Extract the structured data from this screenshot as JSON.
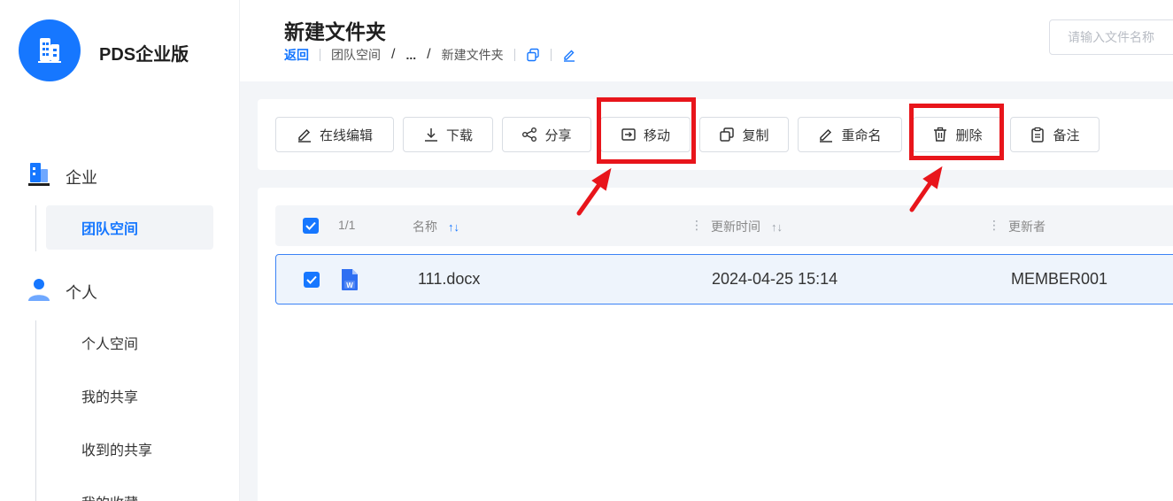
{
  "brand": {
    "name": "PDS企业版"
  },
  "sidebar": {
    "enterprise": {
      "label": "企业",
      "items": [
        {
          "label": "团队空间"
        }
      ]
    },
    "personal": {
      "label": "个人",
      "items": [
        {
          "label": "个人空间"
        },
        {
          "label": "我的共享"
        },
        {
          "label": "收到的共享"
        },
        {
          "label": "我的收藏"
        }
      ]
    }
  },
  "header": {
    "title": "新建文件夹",
    "breadcrumb": {
      "back": "返回",
      "team": "团队空间",
      "ellipsis": "...",
      "current": "新建文件夹",
      "slash": "/"
    },
    "search_placeholder": "请输入文件名称"
  },
  "toolbar": {
    "edit_online": "在线编辑",
    "download": "下载",
    "share": "分享",
    "move": "移动",
    "copy": "复制",
    "rename": "重命名",
    "delete": "删除",
    "note": "备注"
  },
  "table": {
    "count": "1/1",
    "columns": {
      "name": "名称",
      "updated_time": "更新时间",
      "updater": "更新者"
    },
    "rows": [
      {
        "name": "111.docx",
        "updated_time": "2024-04-25 15:14",
        "updater": "MEMBER001"
      }
    ]
  },
  "colors": {
    "accent": "#1677ff",
    "highlight": "#e8151b"
  },
  "icons": {
    "brand": "building-icon",
    "enterprise": "building-icon",
    "personal": "user-icon",
    "edit": "pencil-icon",
    "download": "download-icon",
    "share": "share-icon",
    "move": "move-icon",
    "copy": "copy-icon",
    "rename": "pencil-icon",
    "delete": "trash-icon",
    "note": "clipboard-icon",
    "file": "word-file-icon"
  }
}
